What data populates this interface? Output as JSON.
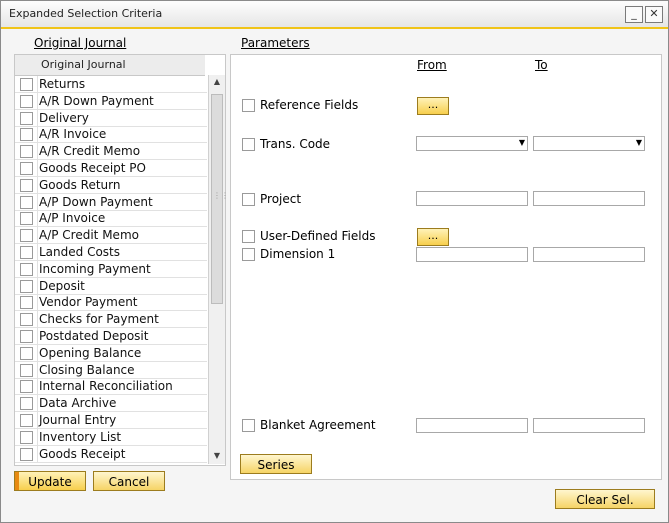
{
  "window": {
    "title": "Expanded Selection Criteria",
    "minimize_glyph": "_",
    "close_glyph": "✕"
  },
  "left": {
    "section_title": "Original Journal",
    "grid_header": "Original Journal",
    "items": [
      {
        "label": "Returns"
      },
      {
        "label": "A/R Down Payment"
      },
      {
        "label": "Delivery"
      },
      {
        "label": "A/R Invoice"
      },
      {
        "label": "A/R Credit Memo"
      },
      {
        "label": "Goods Receipt PO"
      },
      {
        "label": "Goods Return"
      },
      {
        "label": "A/P Down Payment"
      },
      {
        "label": "A/P Invoice"
      },
      {
        "label": "A/P Credit Memo"
      },
      {
        "label": "Landed Costs"
      },
      {
        "label": "Incoming Payment"
      },
      {
        "label": "Deposit"
      },
      {
        "label": "Vendor Payment"
      },
      {
        "label": "Checks for Payment"
      },
      {
        "label": "Postdated Deposit"
      },
      {
        "label": "Opening Balance"
      },
      {
        "label": "Closing Balance"
      },
      {
        "label": "Internal Reconciliation"
      },
      {
        "label": "Data Archive"
      },
      {
        "label": "Journal Entry"
      },
      {
        "label": "Inventory List"
      },
      {
        "label": "Goods Receipt"
      }
    ],
    "scroll_up_glyph": "▲",
    "scroll_down_glyph": "▼",
    "scroll_grip_glyph": "⋮⋮"
  },
  "params": {
    "section_title": "Parameters",
    "from_label": "From",
    "to_label": "To",
    "reference_fields": "Reference Fields",
    "trans_code": "Trans. Code",
    "project": "Project",
    "user_defined_fields": "User-Defined Fields",
    "dimension_1": "Dimension 1",
    "blanket_agreement": "Blanket Agreement",
    "dots": "...",
    "series": "Series"
  },
  "buttons": {
    "update": "Update",
    "cancel": "Cancel",
    "clear_sel": "Clear Sel."
  },
  "colors": {
    "accent": "#f0c419",
    "button_gradient_bottom": "#f7cf4d",
    "update_marker": "#e88a12"
  }
}
